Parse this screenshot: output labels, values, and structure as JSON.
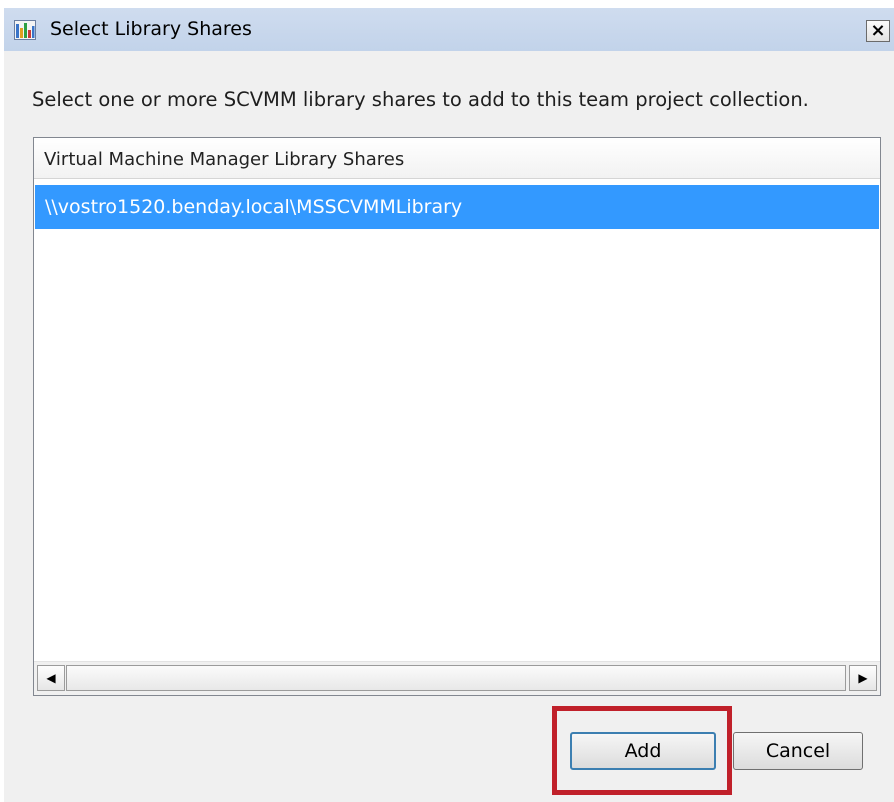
{
  "window": {
    "title": "Select Library Shares",
    "close_glyph": "×",
    "app_icon": "app-window-icon"
  },
  "instruction": "Select one or more SCVMM library shares to add to this team project collection.",
  "list": {
    "column_header": "Virtual Machine Manager Library Shares",
    "rows": [
      {
        "label": "\\\\vostro1520.benday.local\\MSSCVMMLibrary",
        "selected": true
      }
    ],
    "scroll_left_glyph": "◀",
    "scroll_right_glyph": "▶"
  },
  "buttons": {
    "add_label": "Add",
    "cancel_label": "Cancel"
  },
  "colors": {
    "selection": "#3399ff",
    "highlight_annotation": "#c0202a",
    "titlebar": "#c8d8ee"
  }
}
